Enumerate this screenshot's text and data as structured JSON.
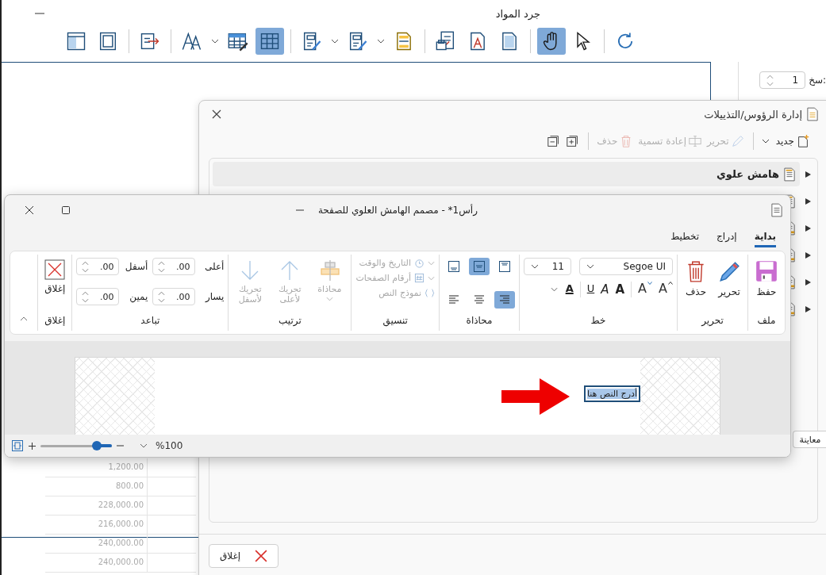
{
  "app": {
    "title": "جرد المواد",
    "toolbar_groups": [
      [
        {
          "kind": "panel",
          "selected": false
        },
        {
          "kind": "frame",
          "selected": false
        }
      ],
      [
        {
          "kind": "export",
          "selected": false
        }
      ],
      [
        {
          "kind": "font",
          "selected": false,
          "dropdown": true
        },
        {
          "kind": "table-edit",
          "selected": false
        },
        {
          "kind": "table",
          "selected": true
        }
      ],
      [
        {
          "kind": "doc-edit",
          "selected": false,
          "dropdown": true
        },
        {
          "kind": "doc-brush",
          "selected": false,
          "dropdown": true
        },
        {
          "kind": "highlight-doc",
          "selected": false
        }
      ],
      [
        {
          "kind": "print",
          "selected": false
        },
        {
          "kind": "text-doc",
          "selected": false
        },
        {
          "kind": "page",
          "selected": false
        }
      ],
      [
        {
          "kind": "hand",
          "selected": true
        },
        {
          "kind": "pointer",
          "selected": false
        }
      ],
      [
        {
          "kind": "refresh",
          "selected": false
        }
      ]
    ],
    "copies": {
      "label": "سخ:",
      "value": "1"
    },
    "table_rows": [
      "1,200.00",
      "800.00",
      "228,000.00",
      "216,000.00",
      "240,000.00",
      "240,000.00"
    ]
  },
  "manager": {
    "title": "إدارة الرؤوس/التذييلات",
    "toolbar": [
      {
        "kind": "new",
        "label": "جديد",
        "disabled": false,
        "dropdown": true
      },
      {
        "kind": "edit",
        "label": "تحرير",
        "disabled": true
      },
      {
        "kind": "rename",
        "label": "إعادة تسمية",
        "disabled": true
      },
      {
        "kind": "delete",
        "label": "حذف",
        "disabled": true
      },
      {
        "kind": "expand",
        "disabled": false
      },
      {
        "kind": "collapse",
        "disabled": false
      }
    ],
    "tree": [
      {
        "kind": "header",
        "label": "هامش علوي",
        "selected": true
      },
      {
        "kind": "header",
        "selected": false
      },
      {
        "kind": "footer",
        "selected": false
      },
      {
        "kind": "footer",
        "selected": false
      },
      {
        "kind": "footer",
        "selected": false
      },
      {
        "kind": "footer",
        "selected": false
      }
    ],
    "preview_button": "معاينة",
    "close_button": "إغلاق"
  },
  "designer": {
    "title": "رأس1* - مصمم الهامش العلوي للصفحة",
    "tabs": [
      {
        "label": "بداية",
        "selected": true
      },
      {
        "label": "إدراج",
        "selected": false
      },
      {
        "label": "تخطيط",
        "selected": false
      }
    ],
    "file_group": {
      "label": "ملف",
      "button": "حفظ"
    },
    "edit_group": {
      "label": "تحرير",
      "buttons": [
        {
          "kind": "edit",
          "label": "تحرير"
        },
        {
          "kind": "delete",
          "label": "حذف"
        }
      ]
    },
    "font_group": {
      "label": "خط",
      "font": "Segoe UI",
      "size": "11",
      "buttons": [
        {
          "kind": "grow",
          "glyph": "A"
        },
        {
          "kind": "shrink",
          "glyph": "A"
        },
        {
          "kind": "bold",
          "glyph": "A"
        },
        {
          "kind": "italic",
          "glyph": "A"
        },
        {
          "kind": "underline",
          "glyph": "U"
        },
        {
          "kind": "color",
          "glyph": "A"
        }
      ]
    },
    "align_group": {
      "label": "محاذاة",
      "buttons": [
        {
          "kind": "top",
          "selected": false
        },
        {
          "kind": "middle",
          "selected": true
        },
        {
          "kind": "bottom",
          "selected": false
        },
        {
          "kind": "right",
          "selected": true
        },
        {
          "kind": "center",
          "selected": false
        },
        {
          "kind": "left",
          "selected": false
        }
      ]
    },
    "format_group": {
      "label": "تنسيق",
      "items": [
        {
          "kind": "date",
          "label": "التاريخ والوقت",
          "dropdown": true,
          "disabled": true
        },
        {
          "kind": "page-number",
          "label": "أرقام الصفحات",
          "dropdown": true,
          "disabled": true
        },
        {
          "kind": "text-field",
          "label": "نموذج النص",
          "disabled": true
        }
      ]
    },
    "arrange_group": {
      "label": "ترتيب",
      "items": [
        {
          "kind": "align",
          "label": "محاذاة",
          "dropdown": true,
          "disabled": true
        },
        {
          "kind": "up",
          "label": "تحريك لأعلى",
          "disabled": true
        },
        {
          "kind": "down",
          "label": "تحريك لأسفل",
          "disabled": true
        }
      ]
    },
    "spacing_group": {
      "label": "تباعد",
      "fields": [
        {
          "label": "أعلى",
          "value": ".00"
        },
        {
          "label": "أسفل",
          "value": ".00"
        },
        {
          "label": "يسار",
          "value": ".00"
        },
        {
          "label": "يمين",
          "value": ".00"
        }
      ]
    },
    "close_group": {
      "label": "إغلاق",
      "button": "إغلاق"
    },
    "canvas": {
      "text": "أدرج النص هنا"
    },
    "status": {
      "zoom": "%100",
      "level": 0.21
    }
  }
}
